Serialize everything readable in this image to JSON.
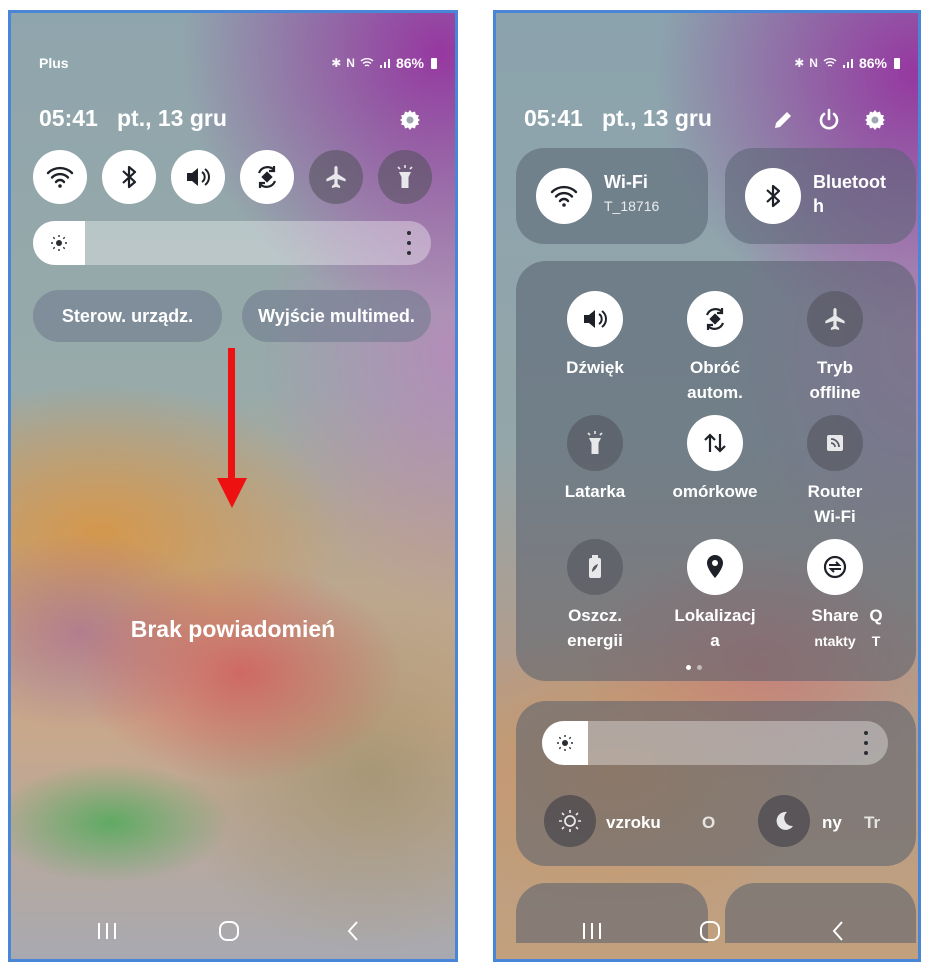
{
  "left_phone": {
    "status": {
      "carrier": "Plus",
      "bt_icon": "bluetooth-icon",
      "nfc_icon": "nfc-icon",
      "wifi_icon": "wifi-icon",
      "signal_icon": "signal-icon",
      "battery": "86%"
    },
    "header": {
      "time": "05:41",
      "date": "pt., 13 gru",
      "settings_icon": "gear-icon"
    },
    "quick_toggles": [
      {
        "name": "wifi-icon",
        "state": "on"
      },
      {
        "name": "bluetooth-icon",
        "state": "on"
      },
      {
        "name": "sound-icon",
        "state": "on"
      },
      {
        "name": "auto-rotate-icon",
        "state": "on"
      },
      {
        "name": "airplane-icon",
        "state": "off"
      },
      {
        "name": "flashlight-icon",
        "state": "off"
      }
    ],
    "brightness": {
      "level": 0.12
    },
    "pills": {
      "device_control": "Sterow. urządz.",
      "media_output": "Wyjście multimed."
    },
    "annotation_color": "#ee1111",
    "empty_message": "Brak powiadomień"
  },
  "right_phone": {
    "status": {
      "battery": "86%"
    },
    "header": {
      "time": "05:41",
      "date": "pt., 13 gru",
      "edit_icon": "pencil-icon",
      "power_icon": "power-icon",
      "settings_icon": "gear-icon"
    },
    "wifi_tile": {
      "title": "Wi-Fi",
      "subtitle": "T_18716"
    },
    "bt_tile": {
      "title_line1": "Bluetoot",
      "title_line2": "h"
    },
    "tiles": [
      {
        "line1": "Dźwięk",
        "line2": "",
        "icon": "sound-icon",
        "state": "on"
      },
      {
        "line1": "Obróć",
        "line2": "autom.",
        "icon": "auto-rotate-icon",
        "state": "on"
      },
      {
        "line1": "Tryb",
        "line2": "offline",
        "icon": "airplane-icon",
        "state": "off"
      },
      {
        "line1": "Latarka",
        "line2": "",
        "icon": "flashlight-icon",
        "state": "off"
      },
      {
        "line1": "omórkowe",
        "line2": "",
        "icon": "mobile-data-icon",
        "state": "on"
      },
      {
        "line1": "Router",
        "line2": "Wi-Fi",
        "icon": "hotspot-icon",
        "state": "off"
      },
      {
        "line1": "Oszcz.",
        "line2": "energii",
        "icon": "power-saving-icon",
        "state": "off"
      },
      {
        "line1": "Lokalizacj",
        "line2": "a",
        "icon": "location-icon",
        "state": "on"
      },
      {
        "line1": "Share",
        "line2": "ntakty",
        "icon": "quick-share-icon",
        "state": "on"
      },
      {
        "line1": "Q",
        "line2": "T",
        "icon": "",
        "state": "partial"
      }
    ],
    "brightness": {
      "level": 0.1
    },
    "bottom_row": {
      "item1": "vzroku",
      "item2": "O",
      "item3": "ny",
      "item4": "Tr"
    },
    "page_dots": 2
  },
  "nav": {
    "recents": "recents-icon",
    "home": "home-icon",
    "back": "back-icon"
  },
  "colors": {
    "tile_on": "#ffffff",
    "frame_border": "#4a86d8"
  }
}
